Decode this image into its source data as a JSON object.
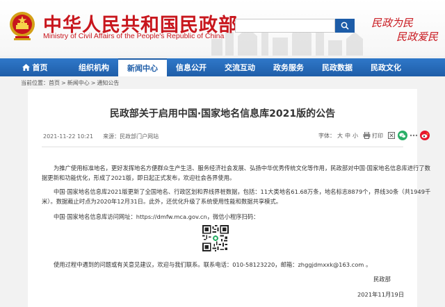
{
  "header": {
    "title": "中华人民共和国民政部",
    "subtitle": "Ministry of Civil Affairs of the People's Republic of China",
    "slogan_line1": "民政为民",
    "slogan_line2": "民政爱民",
    "search_placeholder": ""
  },
  "nav": {
    "items": [
      {
        "label": "首页"
      },
      {
        "label": "组织机构"
      },
      {
        "label": "新闻中心"
      },
      {
        "label": "信息公开"
      },
      {
        "label": "交流互动"
      },
      {
        "label": "政务服务"
      },
      {
        "label": "民政数据"
      },
      {
        "label": "民政文化"
      }
    ],
    "active_index": 2
  },
  "breadcrumb": {
    "prefix": "当前位置：",
    "items": [
      "首页",
      "新闻中心",
      "通知公告"
    ],
    "separator": ">"
  },
  "article": {
    "title": "民政部关于启用中国·国家地名信息库2021版的公告",
    "date": "2021-11-22 10:21",
    "source": "来源：民政部门户网站",
    "font_size_label": "字体：",
    "font_sizes": [
      "大",
      "中",
      "小"
    ],
    "print_label": "打印",
    "paragraph1": [
      "为推广使用标准地名，更好发挥地名方便群众生产生活、服务经济社会发展、弘扬中华优秀传统文化等作用，民政部对中国·国家地名信息库进行了数",
      "据更新和功能优化，形成了2021版，即日起正式发布，欢迎社会各界使用。"
    ],
    "paragraph2": [
      "中国·国家地名信息库2021版更新了全国地名、行政区划和界线界桩数据，包括：11大类地名61.68万条，地名标志8879个，界线30条（共1949千",
      "米）。数据截止时点为2020年12月31日。此外，还优化升级了系统使用性能和数据共享模式。"
    ],
    "paragraph3": "中国·国家地名信息库访问网址：https://dmfw.mca.gov.cn，微信小程序扫码：",
    "paragraph4": "使用过程中遇到的问题或有关意见建议，欢迎与我们联系。联系电话：010-58123220，邮箱：zhggjdmxxk@163.com 。",
    "signature": "民政部",
    "sign_date": "2021年11月19日"
  },
  "colors": {
    "brand_red": "#c8161d",
    "nav_blue": "#1f5ea8",
    "wechat_green": "#2aae67",
    "weibo_orange": "#e6162d"
  }
}
